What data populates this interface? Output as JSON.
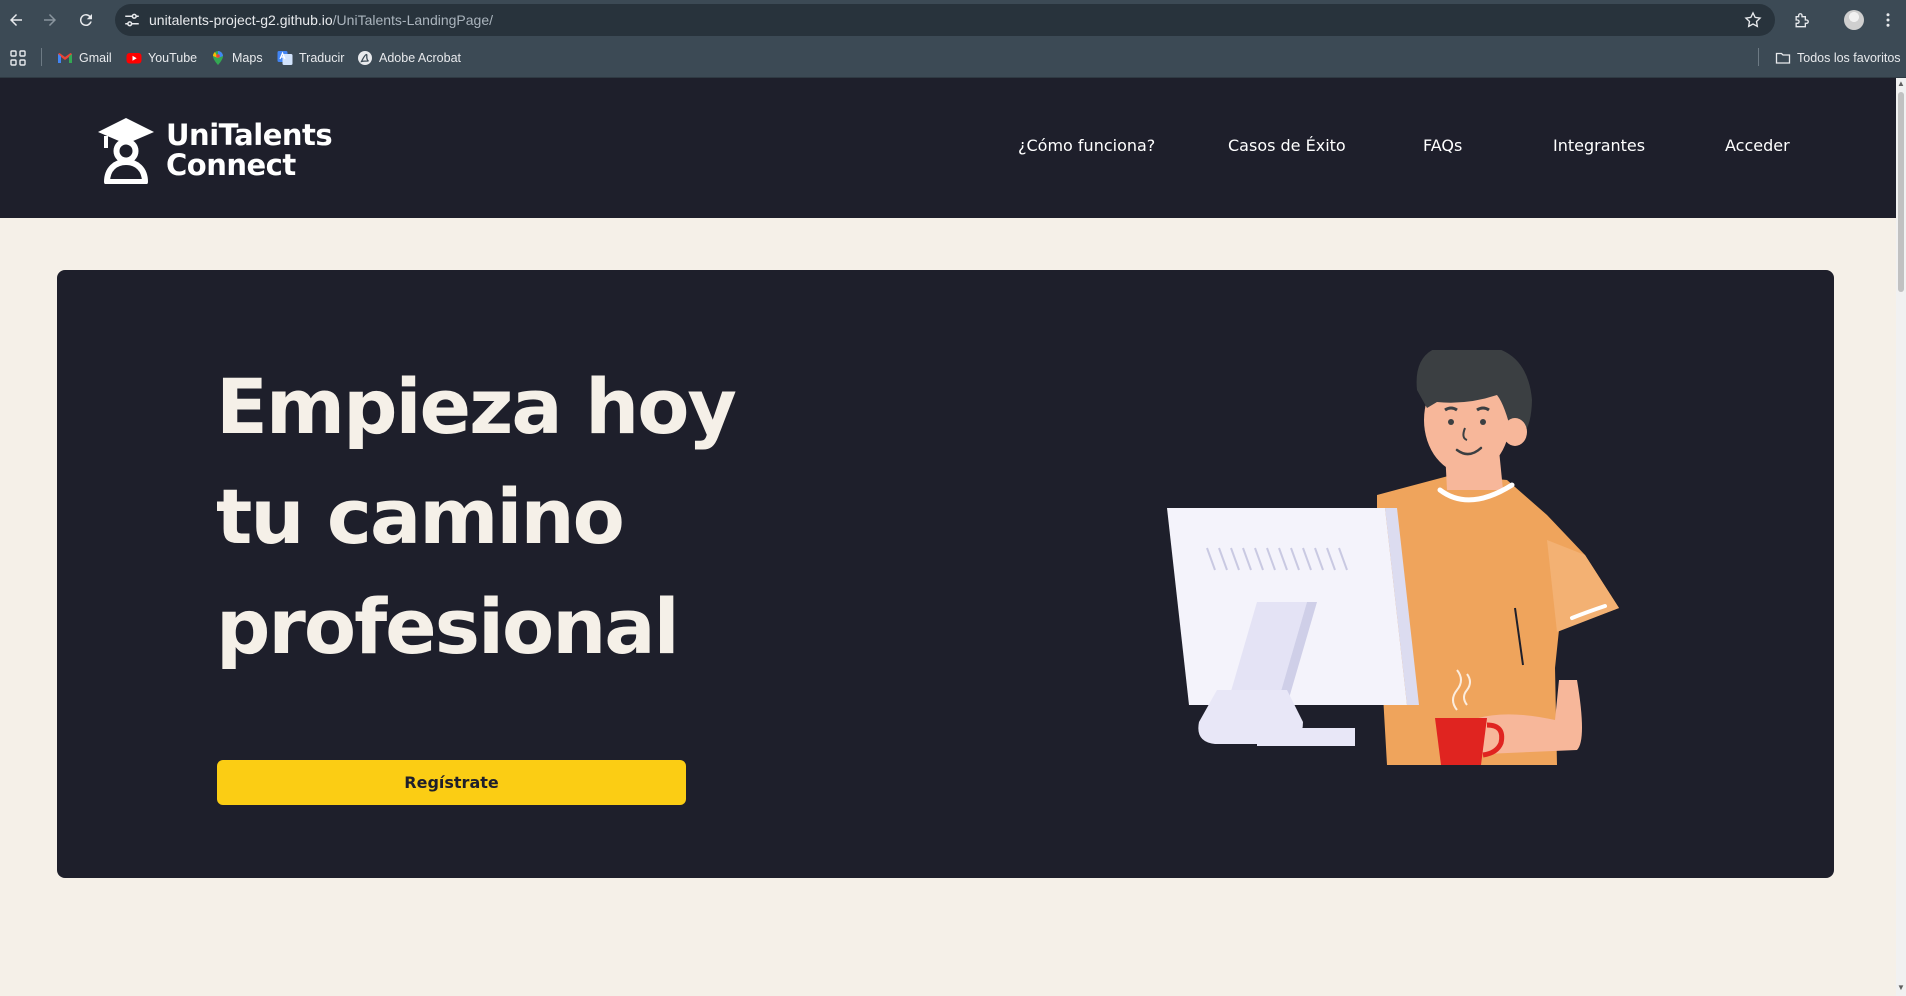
{
  "browser": {
    "url_host": "unitalents-project-g2.github.io",
    "url_path": "/UniTalents-LandingPage/",
    "bookmarks": [
      {
        "label": "Gmail",
        "icon": "gmail-icon"
      },
      {
        "label": "YouTube",
        "icon": "youtube-icon"
      },
      {
        "label": "Maps",
        "icon": "maps-icon"
      },
      {
        "label": "Traducir",
        "icon": "translate-icon"
      },
      {
        "label": "Adobe Acrobat",
        "icon": "acrobat-icon"
      }
    ],
    "all_bookmarks_label": "Todos los favoritos"
  },
  "site": {
    "logo_line1": "UniTalents",
    "logo_line2": "Connect",
    "nav": [
      {
        "label": "¿Cómo funciona?"
      },
      {
        "label": "Casos de Éxito"
      },
      {
        "label": "FAQs"
      },
      {
        "label": "Integrantes"
      },
      {
        "label": "Acceder"
      }
    ]
  },
  "hero": {
    "title_lines": [
      "Empieza hoy",
      "tu camino",
      "profesional"
    ],
    "cta_label": "Regístrate"
  },
  "colors": {
    "header_bg": "#1e1f2b",
    "page_bg": "#f5f0e8",
    "cta_bg": "#fbcd14",
    "hero_text": "#f5f0e8",
    "shirt": "#efa45c",
    "mug": "#e02420"
  }
}
